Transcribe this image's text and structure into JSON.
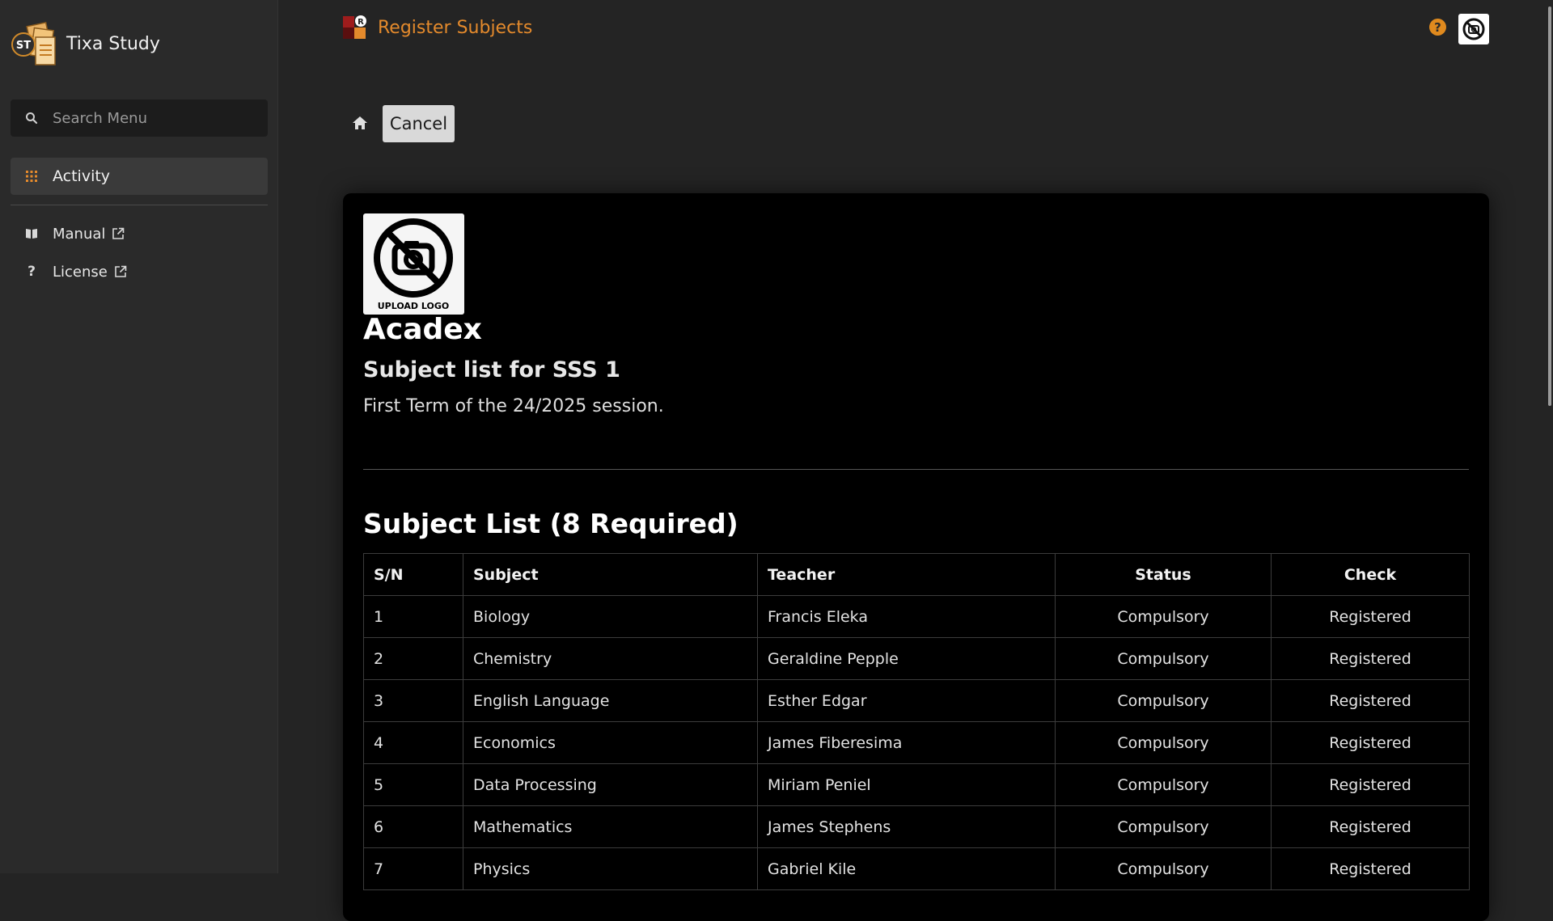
{
  "app": {
    "name": "Tixa Study",
    "logo_text": "ST"
  },
  "sidebar": {
    "search": {
      "placeholder": "Search Menu",
      "value": ""
    },
    "items": [
      {
        "label": "Activity",
        "icon": "grid-icon",
        "active": true
      },
      {
        "label": "Manual",
        "icon": "book-icon",
        "external": true
      },
      {
        "label": "License",
        "icon": "question-icon",
        "external": true
      }
    ]
  },
  "header": {
    "title": "Register Subjects",
    "help_symbol": "?",
    "accent_color": "#e48a2c"
  },
  "toolbar": {
    "cancel_label": "Cancel"
  },
  "report": {
    "logo_caption": "UPLOAD LOGO",
    "school_name": "Acadex",
    "subtitle": "Subject list for SSS 1",
    "session": "First Term of the 24/2025 session.",
    "list_title": "Subject List (8 Required)",
    "columns": [
      "S/N",
      "Subject",
      "Teacher",
      "Status",
      "Check"
    ],
    "rows": [
      [
        "1",
        "Biology",
        "Francis Eleka",
        "Compulsory",
        "Registered"
      ],
      [
        "2",
        "Chemistry",
        "Geraldine Pepple",
        "Compulsory",
        "Registered"
      ],
      [
        "3",
        "English Language",
        "Esther Edgar",
        "Compulsory",
        "Registered"
      ],
      [
        "4",
        "Economics",
        "James Fiberesima",
        "Compulsory",
        "Registered"
      ],
      [
        "5",
        "Data Processing",
        "Miriam Peniel",
        "Compulsory",
        "Registered"
      ],
      [
        "6",
        "Mathematics",
        "James Stephens",
        "Compulsory",
        "Registered"
      ],
      [
        "7",
        "Physics",
        "Gabriel Kile",
        "Compulsory",
        "Registered"
      ]
    ]
  }
}
